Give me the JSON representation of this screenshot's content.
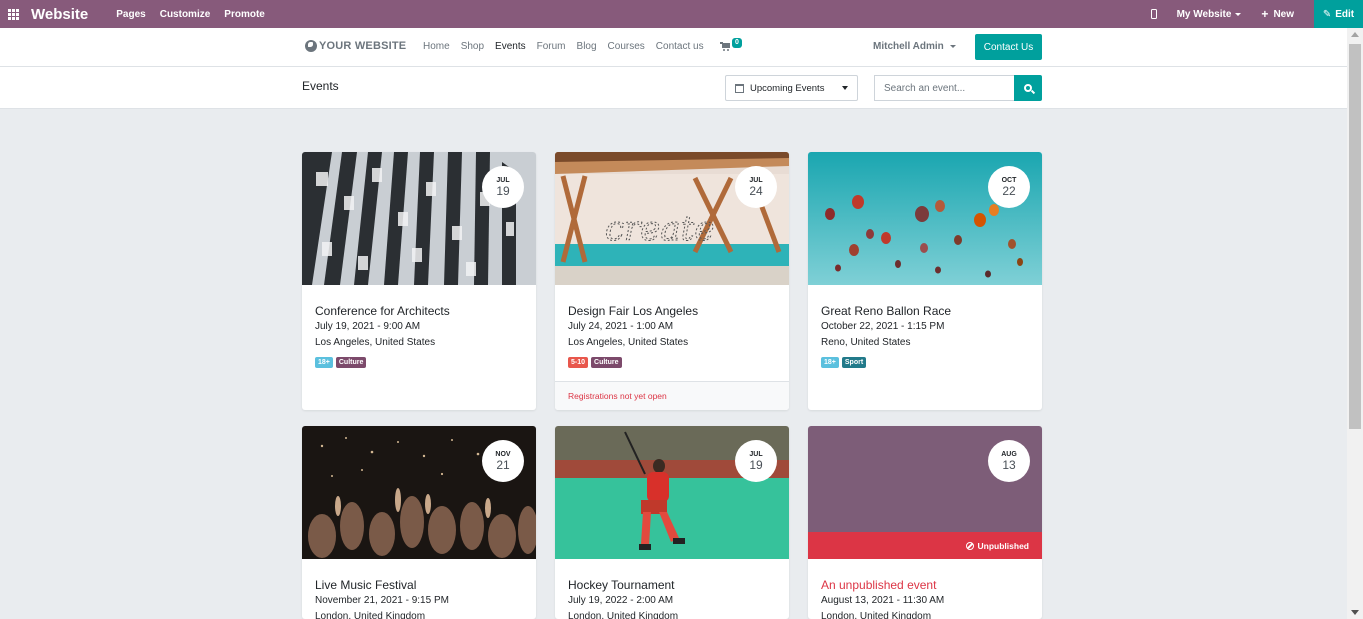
{
  "admin_bar": {
    "brand": "Website",
    "menu": [
      "Pages",
      "Customize",
      "Promote"
    ],
    "site_selector": "My Website",
    "new_label": "New",
    "edit_label": "Edit",
    "colors": {
      "bar": "#875a7b",
      "edit": "#00a09d"
    }
  },
  "header": {
    "logo": "YOUR WEBSITE",
    "nav": [
      "Home",
      "Shop",
      "Events",
      "Forum",
      "Blog",
      "Courses",
      "Contact us"
    ],
    "active_nav": "Events",
    "cart_count": "0",
    "user": "Mitchell Admin",
    "contact_button": "Contact Us"
  },
  "subheader": {
    "title": "Events",
    "filter": "Upcoming Events",
    "search_placeholder": "Search an event..."
  },
  "events": [
    {
      "month": "JUL",
      "day": "19",
      "title": "Conference for Architects",
      "date": "July 19, 2021 - 9:00 AM",
      "location": "Los Angeles, United States",
      "tags": [
        {
          "label": "18+",
          "color": "#5bc0de"
        },
        {
          "label": "Culture",
          "color": "#7c4a6b"
        }
      ],
      "image": "building-facade",
      "footer": ""
    },
    {
      "month": "JUL",
      "day": "24",
      "title": "Design Fair Los Angeles",
      "date": "July 24, 2021 - 1:00 AM",
      "location": "Los Angeles, United States",
      "tags": [
        {
          "label": "5-10",
          "color": "#e8574c"
        },
        {
          "label": "Culture",
          "color": "#7c4a6b"
        }
      ],
      "image": "create-wall",
      "footer": "Registrations not yet open"
    },
    {
      "month": "OCT",
      "day": "22",
      "title": "Great Reno Ballon Race",
      "date": "October 22, 2021 - 1:15 PM",
      "location": "Reno, United States",
      "tags": [
        {
          "label": "18+",
          "color": "#5bc0de"
        },
        {
          "label": "Sport",
          "color": "#227a8a"
        }
      ],
      "image": "hot-air-balloons",
      "footer": ""
    },
    {
      "month": "NOV",
      "day": "21",
      "title": "Live Music Festival",
      "date": "November 21, 2021 - 9:15 PM",
      "location": "London, United Kingdom",
      "tags": [],
      "image": "concert-crowd",
      "footer": ""
    },
    {
      "month": "JUL",
      "day": "19",
      "title": "Hockey Tournament",
      "date": "July 19, 2022 - 2:00 AM",
      "location": "London, United Kingdom",
      "tags": [],
      "image": "hockey-player",
      "footer": ""
    },
    {
      "month": "AUG",
      "day": "13",
      "title": "An unpublished event",
      "date": "August 13, 2021 - 11:30 AM",
      "location": "London, United Kingdom",
      "tags": [],
      "image": "placeholder",
      "footer": "",
      "status": "Unpublished"
    }
  ]
}
